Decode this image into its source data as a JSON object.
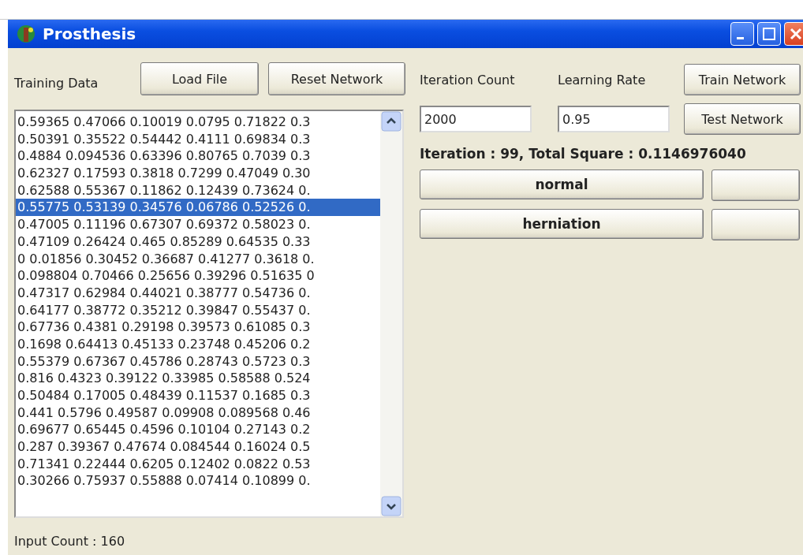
{
  "window": {
    "title": "Prosthesis"
  },
  "training": {
    "label": "Training Data",
    "buttons": [
      "Load File",
      "Reset Network"
    ],
    "rows": [
      {
        "text": "0.59365 0.47066 0.10019 0.0795 0.71822 0.3",
        "selected": false
      },
      {
        "text": "0.50391 0.35522 0.54442 0.4111 0.69834 0.3",
        "selected": false
      },
      {
        "text": "0.4884 0.094536 0.63396 0.80765 0.7039 0.3",
        "selected": false
      },
      {
        "text": "0.62327 0.17593 0.3818 0.7299 0.47049 0.30",
        "selected": false
      },
      {
        "text": "0.62588 0.55367 0.11862 0.12439 0.73624 0.",
        "selected": false
      },
      {
        "text": "0.55775 0.53139 0.34576 0.06786 0.52526 0.",
        "selected": true
      },
      {
        "text": "0.47005 0.11196 0.67307 0.69372 0.58023 0.",
        "selected": false
      },
      {
        "text": "0.47109 0.26424 0.465 0.85289 0.64535 0.33",
        "selected": false
      },
      {
        "text": "0 0.01856 0.30452 0.36687 0.41277 0.3618 0.",
        "selected": false
      },
      {
        "text": "0.098804 0.70466 0.25656 0.39296 0.51635 0",
        "selected": false
      },
      {
        "text": "0.47317 0.62984 0.44021 0.38777 0.54736 0.",
        "selected": false
      },
      {
        "text": "0.64177 0.38772 0.35212 0.39847 0.55437 0.",
        "selected": false
      },
      {
        "text": "0.67736 0.4381 0.29198 0.39573 0.61085 0.3",
        "selected": false
      },
      {
        "text": "0.1698 0.64413 0.45133 0.23748 0.45206 0.2",
        "selected": false
      },
      {
        "text": "0.55379 0.67367 0.45786 0.28743 0.5723 0.3",
        "selected": false
      },
      {
        "text": "0.816 0.4323 0.39122 0.33985 0.58588 0.524",
        "selected": false
      },
      {
        "text": "0.50484 0.17005 0.48439 0.11537 0.1685 0.3",
        "selected": false
      },
      {
        "text": "0.441 0.5796 0.49587 0.09908 0.089568 0.46",
        "selected": false
      },
      {
        "text": "0.69677 0.65445 0.4596 0.10104 0.27143 0.2",
        "selected": false
      },
      {
        "text": "0.287 0.39367 0.47674 0.084544 0.16024 0.5",
        "selected": false
      },
      {
        "text": "0.71341 0.22444 0.6205 0.12402 0.0822 0.53",
        "selected": false
      },
      {
        "text": "0.30266 0.75937 0.55888 0.07414 0.10899 0.",
        "selected": false
      }
    ],
    "status": "Input Count : 160"
  },
  "settings": {
    "fields": [
      {
        "label": "Iteration Count",
        "value": "2000"
      },
      {
        "label": "Learning Rate",
        "value": "0.95"
      }
    ],
    "buttons": [
      "Train Network",
      "Test Network"
    ],
    "progress": "Iteration : 99, Total Square : 0.1146976040",
    "results": [
      {
        "label": "normal"
      },
      {
        "label": "herniation"
      }
    ]
  }
}
